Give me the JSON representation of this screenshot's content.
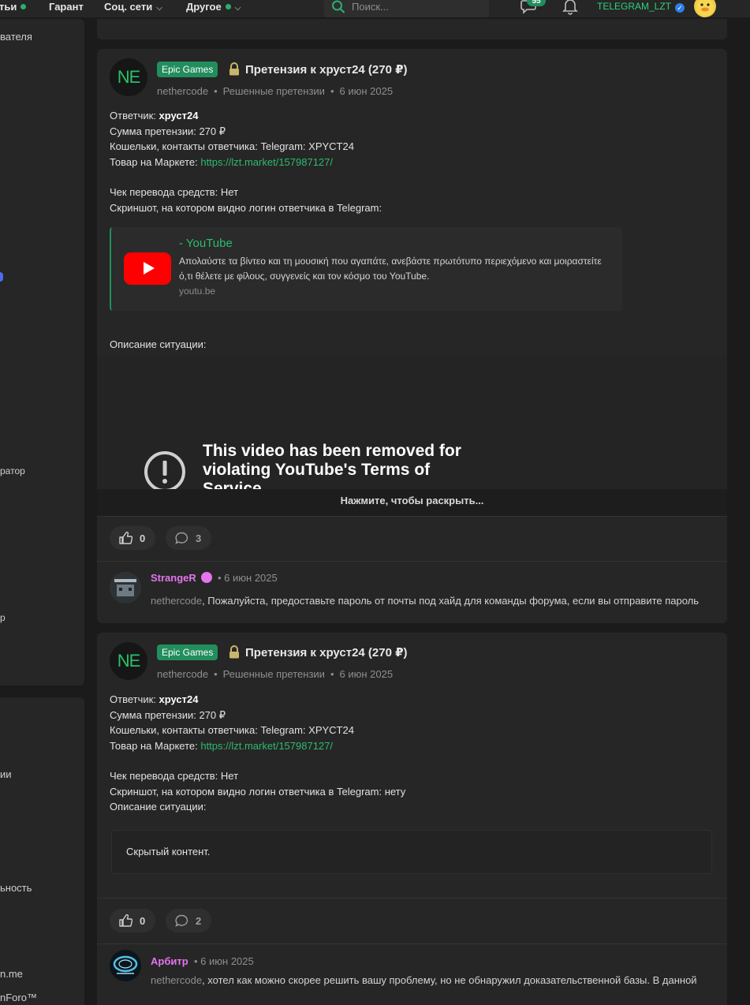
{
  "nav": {
    "items": [
      {
        "label": "тьи",
        "dot": true
      },
      {
        "label": "Гарант"
      },
      {
        "label": "Соц. сети",
        "chevron": true
      },
      {
        "label": "Другое",
        "dot": true,
        "chevron": true
      }
    ],
    "search_placeholder": "Поиск...",
    "messages_badge": "55",
    "username": "TELEGRAM_LZT"
  },
  "sidebar": {
    "fragments": [
      "вателя",
      "ратор",
      "р",
      "ии",
      "ьность",
      "n.me",
      "nForo™"
    ]
  },
  "posts": [
    {
      "avatar": "NE",
      "tag": "Epic Games",
      "title": "Претензия к хруст24 (270 ₽)",
      "author": "nethercode",
      "category": "Решенные претензии",
      "date": "6 июн 2025",
      "lines": {
        "respondent_label": "Ответчик: ",
        "respondent": "хруст24",
        "amount": "Сумма претензии: 270 ₽",
        "wallets": "Кошельки, контакты ответчика: Telegram: XPYCT24",
        "market_label": "Товар на Маркете: ",
        "market_link": "https://lzt.market/157987127/",
        "receipt": "Чек перевода средств: Нет",
        "screenshot": "Скриншот, на котором видно логин ответчика в Telegram:",
        "situation": "Описание ситуации:"
      },
      "embed": {
        "title": "- YouTube",
        "description": "Απολαύστε τα βίντεο και τη μουσική που αγαπάτε, ανεβάστε πρωτότυπο περιεχόμενο και μοιραστείτε ό,τι θέλετε με φίλους, συγγενείς και τον κόσμο του YouTube.",
        "domain": "youtu.be"
      },
      "video_removed": "This video has been removed for violating YouTube's Terms of Service",
      "expand_label": "Нажмите, чтобы раскрыть...",
      "likes": "0",
      "comments": "3",
      "comment": {
        "user": "StrangeR",
        "date": "6 июн 2025",
        "mention": "nethercode",
        "text": ", Пожалуйста, предоставьте пароль от почты под хайд для команды форума, если вы отправите пароль"
      }
    },
    {
      "avatar": "NE",
      "tag": "Epic Games",
      "title": "Претензия к хруст24 (270 ₽)",
      "author": "nethercode",
      "category": "Решенные претензии",
      "date": "6 июн 2025",
      "lines": {
        "respondent_label": "Ответчик: ",
        "respondent": "хруст24",
        "amount": "Сумма претензии: 270 ₽",
        "wallets": "Кошельки, контакты ответчика: Telegram: XPYCT24",
        "market_label": "Товар на Маркете: ",
        "market_link": "https://lzt.market/157987127/",
        "receipt": "Чек перевода средств: Нет",
        "screenshot": "Скриншот, на котором видно логин ответчика в Telegram: нету",
        "situation": "Описание ситуации:"
      },
      "hidden": "Скрытый контент.",
      "likes": "0",
      "comments": "2",
      "comment": {
        "user": "Арбитр",
        "date": "6 июн 2025",
        "mention": "nethercode",
        "text": ", хотел как можно скорее решить вашу проблему, но не обнаружил доказательственной базы. В данной"
      }
    }
  ]
}
